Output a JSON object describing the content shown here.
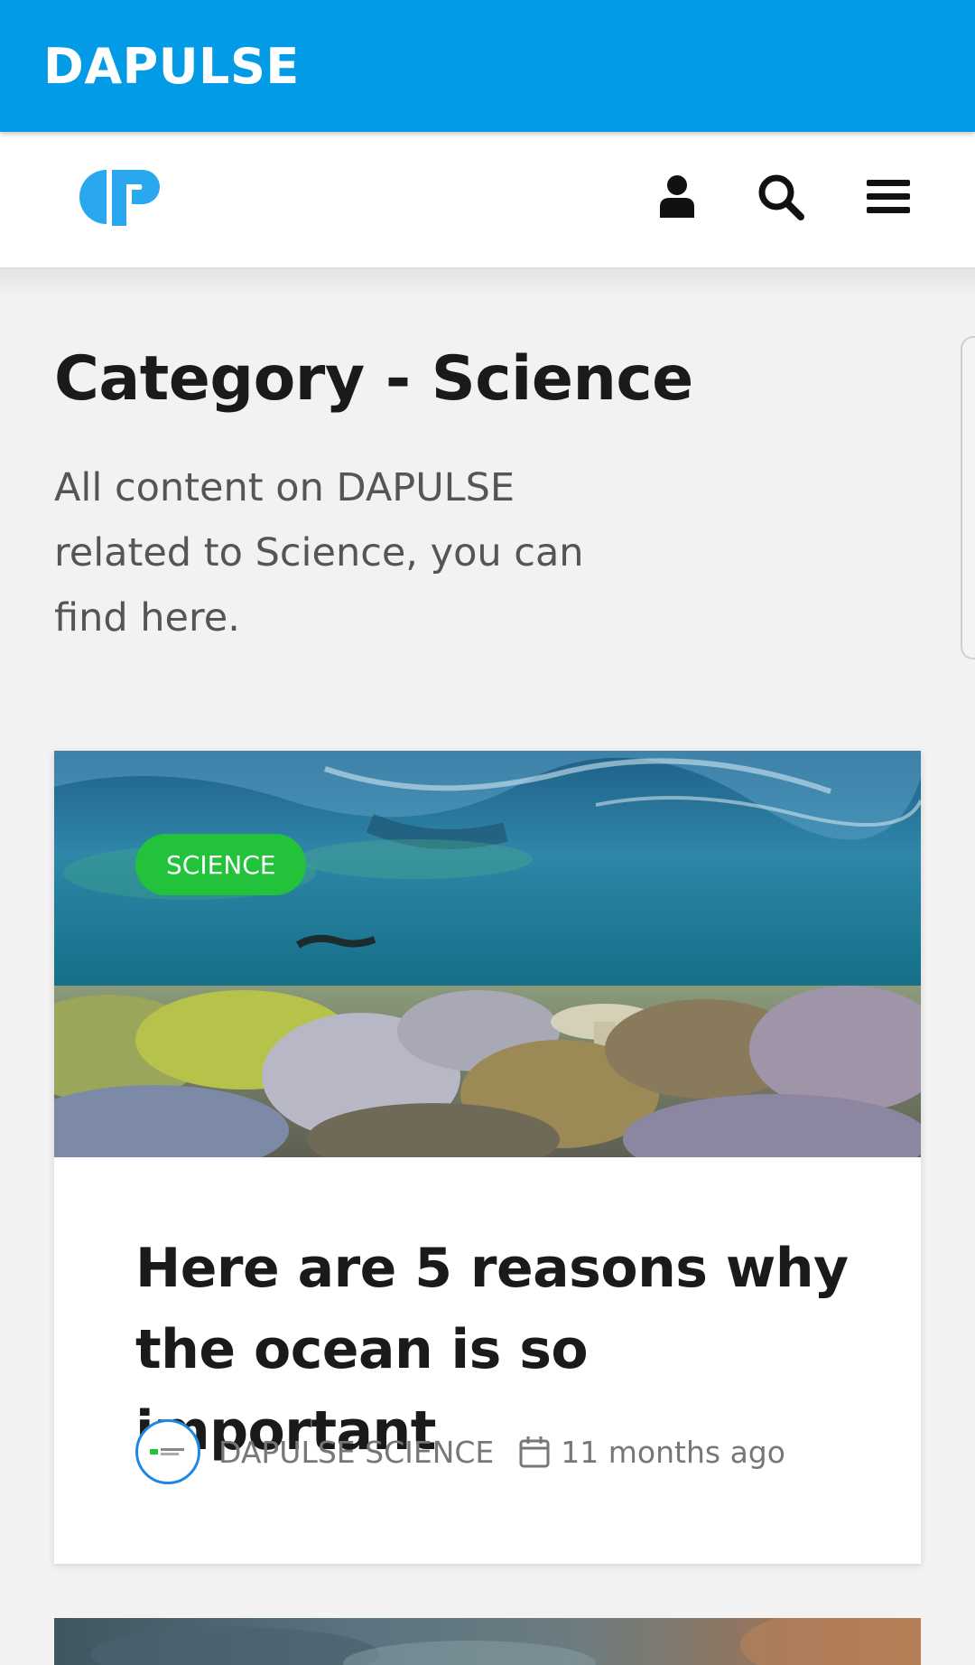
{
  "appbar": {
    "title": "DAPULSE"
  },
  "header": {
    "logo_icon": "dp-logo-icon",
    "account_icon": "user-icon",
    "search_icon": "search-icon",
    "menu_icon": "hamburger-menu-icon"
  },
  "page": {
    "title": "Category - Science",
    "description": "All content on DAPULSE related to Science, you can find here."
  },
  "posts": [
    {
      "category": "SCIENCE",
      "title": "Here are 5 reasons why the ocean is so important",
      "author": "DAPULSE SCIENCE",
      "time": "11 months ago"
    }
  ],
  "colors": {
    "appbar": "#039be5",
    "logo": "#29a8f0",
    "badge": "#22c23a",
    "avatar_ring": "#1e88e5"
  }
}
